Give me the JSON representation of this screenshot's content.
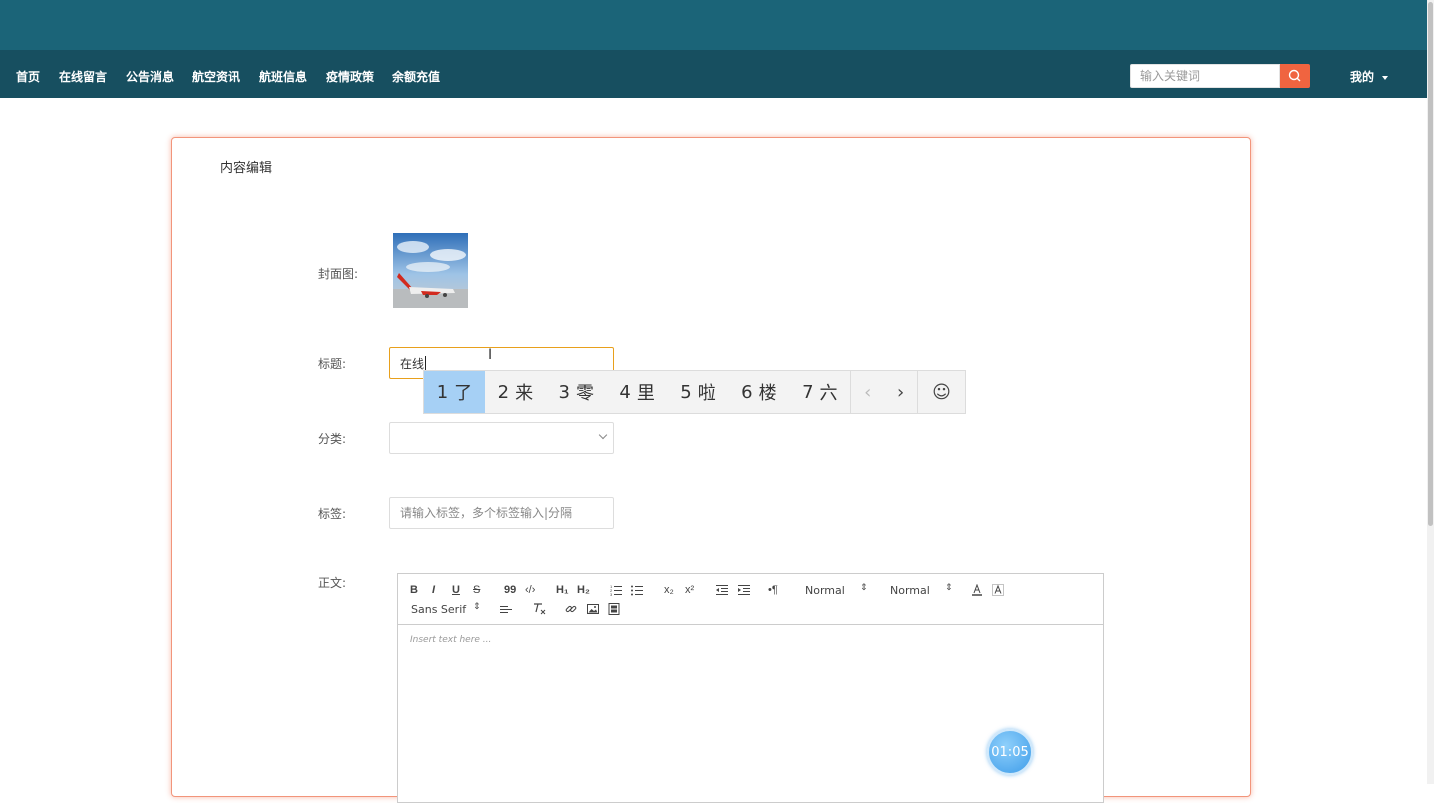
{
  "nav": {
    "items": [
      {
        "label": "首页"
      },
      {
        "label": "在线留言"
      },
      {
        "label": "公告消息"
      },
      {
        "label": "航空资讯"
      },
      {
        "label": "航班信息"
      },
      {
        "label": "疫情政策"
      },
      {
        "label": "余额充值"
      }
    ],
    "search_placeholder": "输入关键词",
    "user_label": "我的"
  },
  "form": {
    "card_title": "内容编辑",
    "cover_label": "封面图:",
    "title_label": "标题:",
    "title_value": "在线",
    "category_label": "分类:",
    "category_value": "",
    "tags_label": "标签:",
    "tags_placeholder": "请输入标签，多个标签输入|分隔",
    "body_label": "正文:"
  },
  "ime": {
    "candidates": [
      {
        "num": "1",
        "text": "了"
      },
      {
        "num": "2",
        "text": "来"
      },
      {
        "num": "3",
        "text": "零"
      },
      {
        "num": "4",
        "text": "里"
      },
      {
        "num": "5",
        "text": "啦"
      },
      {
        "num": "6",
        "text": "楼"
      },
      {
        "num": "7",
        "text": "六"
      }
    ],
    "prev": "‹",
    "next": "›",
    "emoji": "☺"
  },
  "editor": {
    "bold": "B",
    "italic": "I",
    "underline": "U",
    "strike": "S",
    "quote": "99",
    "code": "‹/›",
    "h1": "H₁",
    "h2": "H₂",
    "sub": "x₂",
    "sup": "x²",
    "para": "•¶",
    "size_value": "Normal",
    "header_value": "Normal",
    "font_value": "Sans Serif",
    "placeholder": "Insert text here ..."
  },
  "timer": {
    "value": "01:05"
  },
  "colors": {
    "header_top": "#1b6478",
    "nav_bar": "#174f60",
    "search_button": "#f06440",
    "card_border": "#f2957b",
    "ime_selected": "#a6d0f5"
  }
}
